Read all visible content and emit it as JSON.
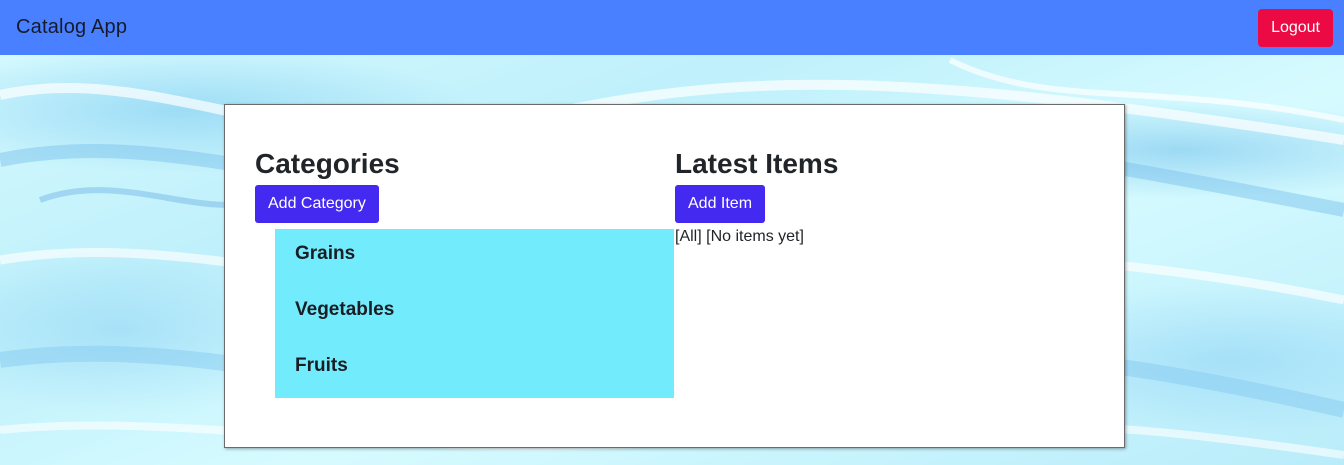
{
  "navbar": {
    "brand": "Catalog App",
    "logout_label": "Logout",
    "background": "#4880ff",
    "logout_color": "#eb0a44"
  },
  "categories": {
    "heading": "Categories",
    "add_label": "Add Category",
    "items": [
      {
        "label": "Grains"
      },
      {
        "label": "Vegetables"
      },
      {
        "label": "Fruits"
      }
    ],
    "list_background": "#72ecfc"
  },
  "latest": {
    "heading": "Latest Items",
    "add_label": "Add Item",
    "status_text": "[All] [No items yet]"
  },
  "accent_button_color": "#4429f0"
}
